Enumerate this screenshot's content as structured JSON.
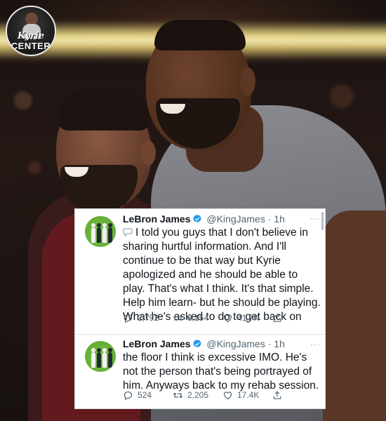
{
  "brand": {
    "logo_line1": "Kyrie",
    "logo_line2": "CENTER"
  },
  "tweets": [
    {
      "name": "LeBron James",
      "handle": "@KingJames",
      "separator": "·",
      "time": "1h",
      "body": "I told you guys that I don't believe in sharing hurtful information. And I'll continue to be that way but Kyrie apologized and he should be able to play. That's what I think. It's that simple.  Help him learn- but he should be playing. What he's asked to do to get back on",
      "replies": "2,792",
      "retweets": "8,154",
      "likes": "41.7K",
      "more_label": "···"
    },
    {
      "name": "LeBron James",
      "handle": "@KingJames",
      "separator": "·",
      "time": "1h",
      "body": "the floor I think is excessive IMO. He's not the person that's being portrayed of him. Anyways back to my rehab session.",
      "replies": "524",
      "retweets": "2,205",
      "likes": "17.4K",
      "more_label": "···"
    }
  ],
  "colors": {
    "verified": "#1d9bf0",
    "text": "#0f1419",
    "muted": "#536471",
    "avatar_bg": "#6bb83a"
  },
  "icons": [
    "reply-icon",
    "retweet-icon",
    "like-icon",
    "share-icon",
    "verified-badge-icon",
    "speech-bubble-icon"
  ]
}
